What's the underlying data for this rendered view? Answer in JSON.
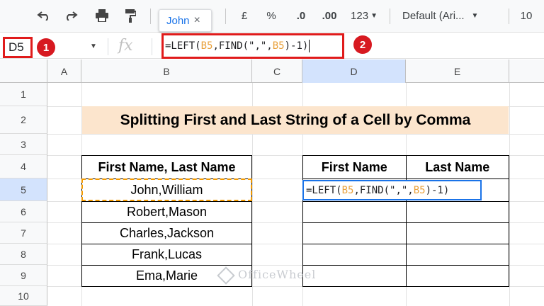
{
  "toolbar": {
    "font_name": "Default (Ari...",
    "font_size": "10",
    "currency": "£",
    "percent": "%",
    "dec_less": ".0",
    "dec_more": ".00",
    "number_format": "123",
    "tooltip": "John"
  },
  "formula_bar": {
    "cell_ref": "D5",
    "fx": "fx",
    "badge_1": "1",
    "badge_2": "2"
  },
  "formula": {
    "p1": "=LEFT(",
    "p2": "B5",
    "p3": ",FIND(\",\",",
    "p4": "B5",
    "p5": ")-1)"
  },
  "columns": [
    "A",
    "B",
    "C",
    "D",
    "E"
  ],
  "rows": [
    "1",
    "2",
    "3",
    "4",
    "5",
    "6",
    "7",
    "8",
    "9",
    "10"
  ],
  "title": "Splitting First and Last String of a Cell by Comma",
  "table1": {
    "header": "First Name, Last Name",
    "rows": [
      "John,William",
      "Robert,Mason",
      "Charles,Jackson",
      "Frank,Lucas",
      "Ema,Marie"
    ]
  },
  "table2": {
    "headers": [
      "First Name",
      "Last Name"
    ]
  },
  "watermark": "OfficeWheel"
}
